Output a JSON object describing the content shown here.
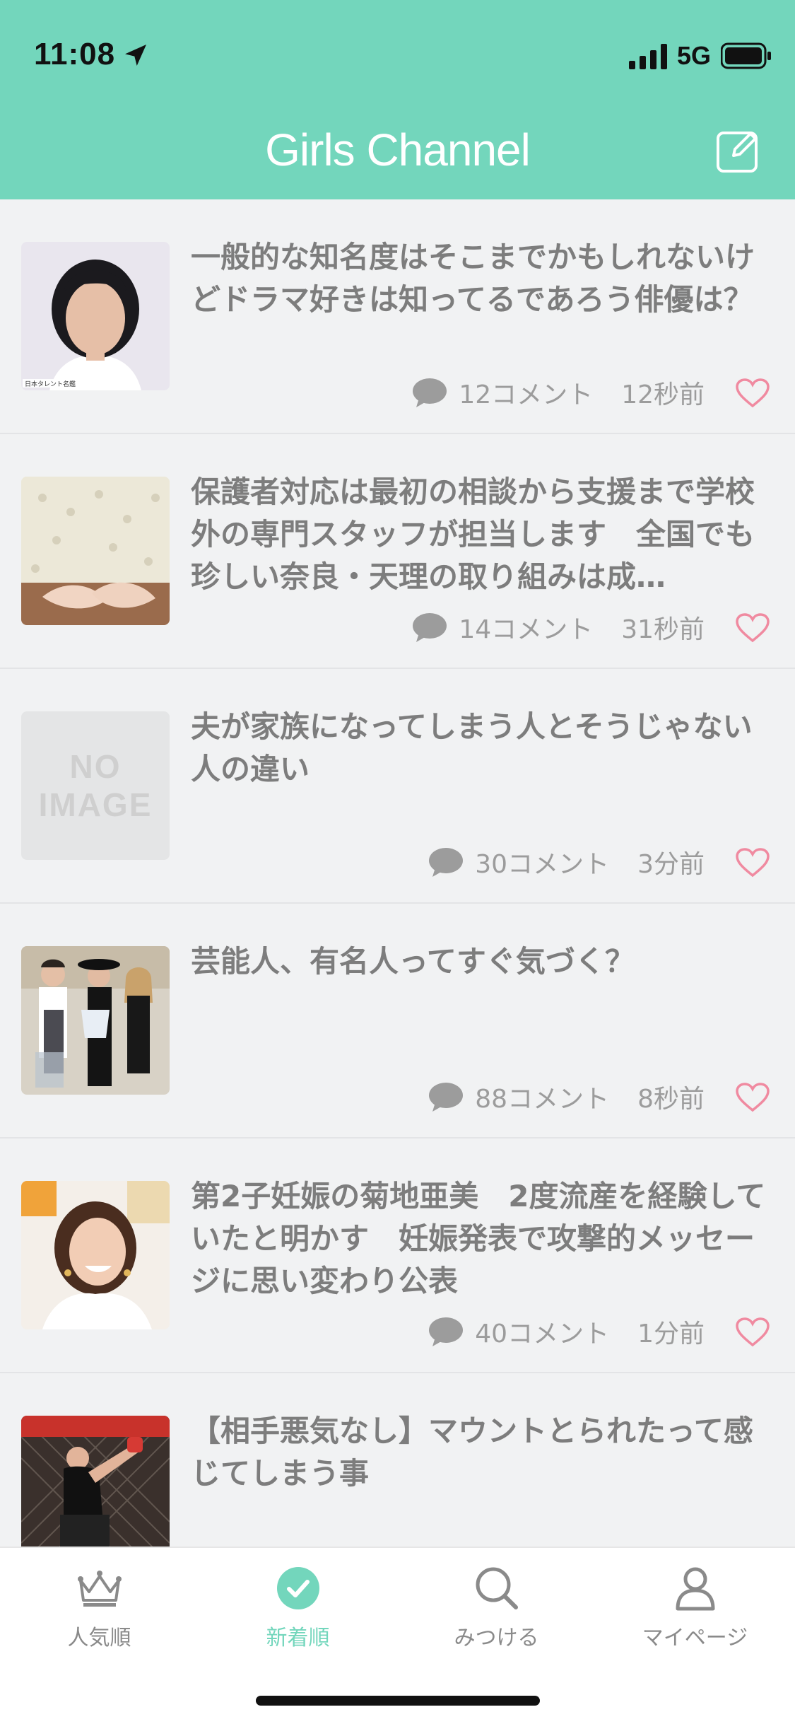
{
  "status_bar": {
    "time": "11:08",
    "network": "5G"
  },
  "header": {
    "title": "Girls Channel",
    "compose_icon": "compose-icon"
  },
  "feed": [
    {
      "title": "一般的な知名度はそこまでかもしれないけどドラマ好きは知ってるであろう俳優は？",
      "comments": "12コメント",
      "time": "12秒前",
      "thumb_caption": "日本タレント名鑑"
    },
    {
      "title": "保護者対応は最初の相談から支援まで学校外の専門スタッフが担当します　全国でも珍しい奈良・天理の取り組みは成…",
      "comments": "14コメント",
      "time": "31秒前"
    },
    {
      "title": "夫が家族になってしまう人とそうじゃない人の違い",
      "comments": "30コメント",
      "time": "3分前",
      "no_image_line1": "NO",
      "no_image_line2": "IMAGE"
    },
    {
      "title": "芸能人、有名人ってすぐ気づく？",
      "comments": "88コメント",
      "time": "8秒前"
    },
    {
      "title": "第2子妊娠の菊地亜美　2度流産を経験していたと明かす　妊娠発表で攻撃的メッセージに思い変わり公表",
      "comments": "40コメント",
      "time": "1分前"
    },
    {
      "title": "【相手悪気なし】マウントとられたって感じてしまう事"
    }
  ],
  "tabbar": {
    "tabs": [
      {
        "label": "人気順",
        "icon": "crown-icon"
      },
      {
        "label": "新着順",
        "icon": "check-circle-icon",
        "active": true
      },
      {
        "label": "みつける",
        "icon": "search-icon"
      },
      {
        "label": "マイページ",
        "icon": "person-icon"
      }
    ]
  },
  "colors": {
    "brand": "#73d6bc",
    "heart": "#f08aa0",
    "text": "#7d7d7d"
  }
}
